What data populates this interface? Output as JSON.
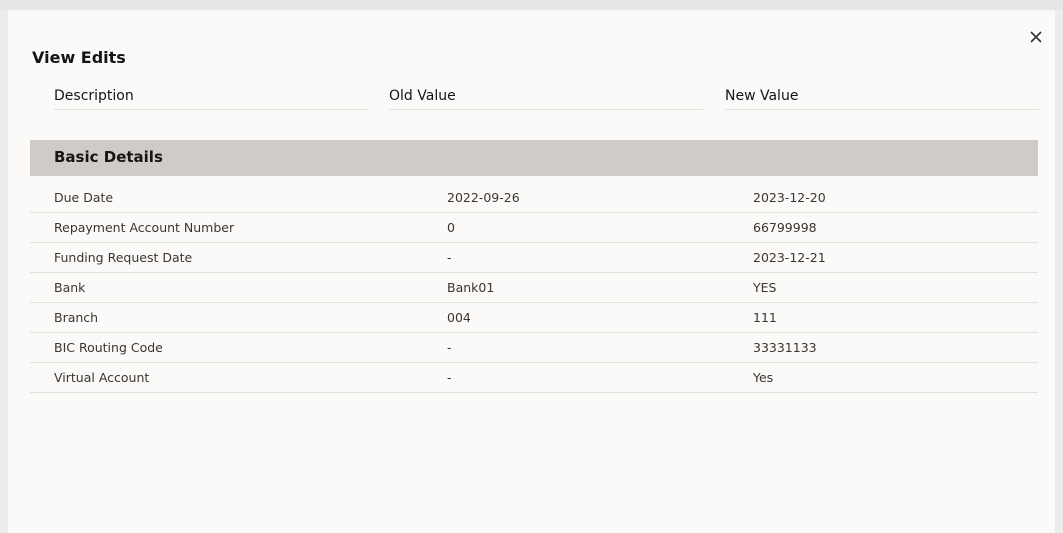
{
  "dialog": {
    "title": "View Edits",
    "close_icon": "close-icon"
  },
  "columns": {
    "description": "Description",
    "old_value": "Old Value",
    "new_value": "New Value"
  },
  "section": {
    "title": "Basic Details"
  },
  "rows": [
    {
      "description": "Due Date",
      "old": "2022-09-26",
      "new": "2023-12-20"
    },
    {
      "description": "Repayment Account Number",
      "old": "0",
      "new": "66799998"
    },
    {
      "description": "Funding Request Date",
      "old": "-",
      "new": "2023-12-21"
    },
    {
      "description": "Bank",
      "old": "Bank01",
      "new": "YES"
    },
    {
      "description": "Branch",
      "old": "004",
      "new": "111"
    },
    {
      "description": "BIC Routing Code",
      "old": "-",
      "new": "33331133"
    },
    {
      "description": "Virtual Account",
      "old": "-",
      "new": "Yes"
    }
  ]
}
